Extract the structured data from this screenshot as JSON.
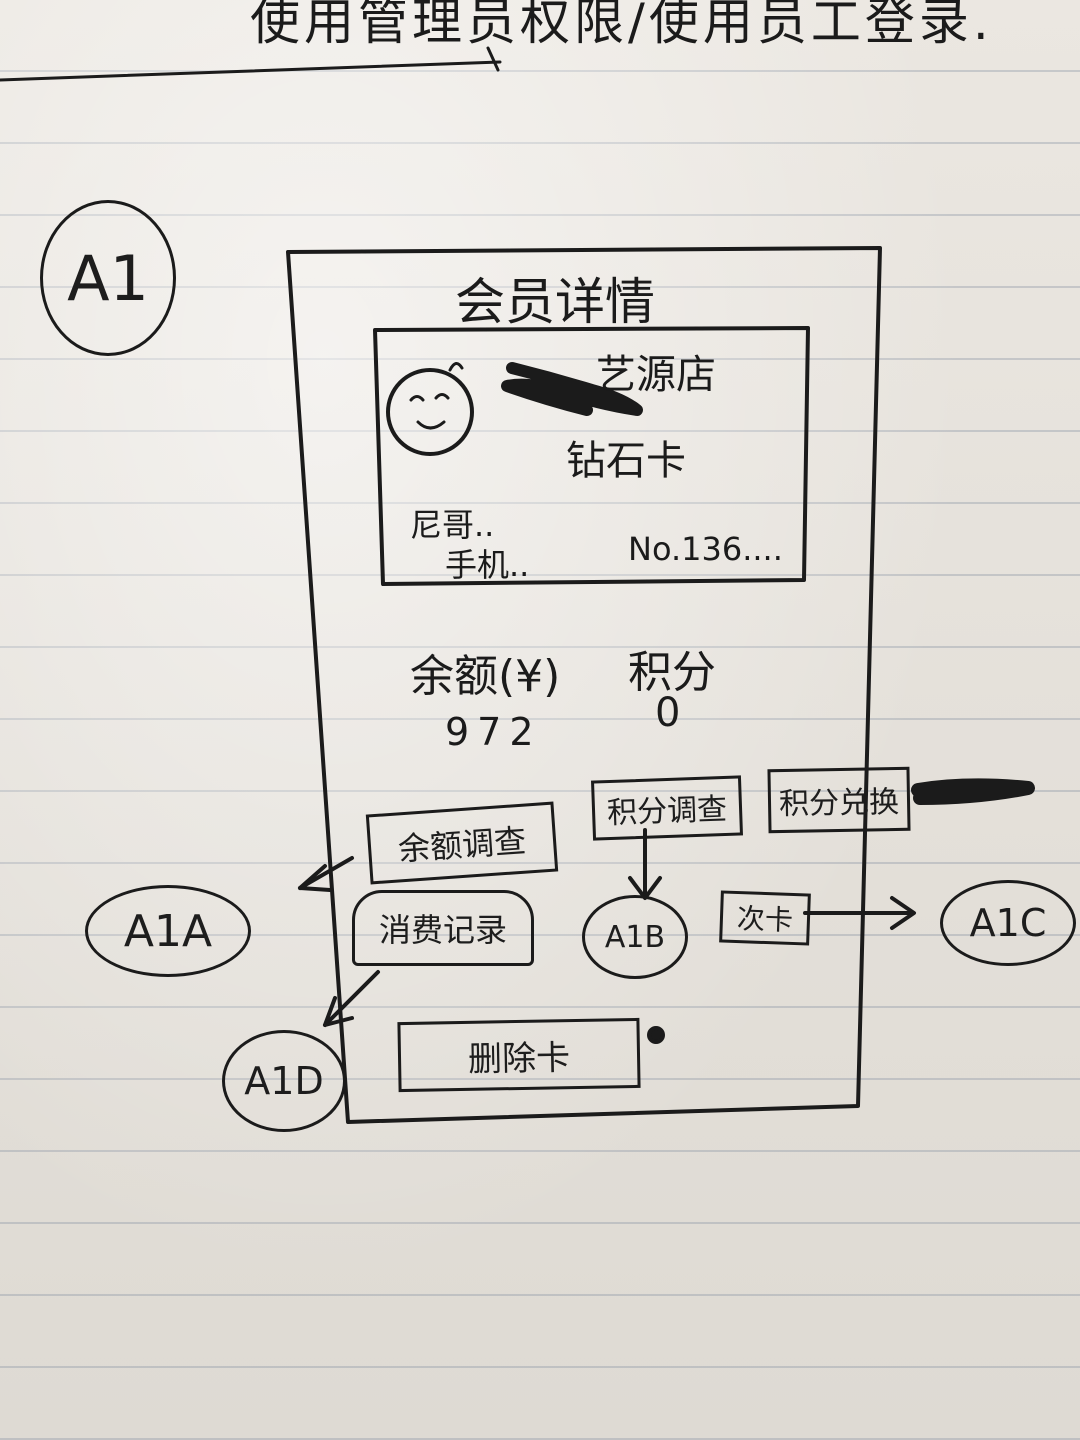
{
  "top_note": "使用管理员权限/使用员工登录.",
  "page_code": "A1",
  "screen": {
    "title": "会员详情",
    "profile": {
      "level_store": "艺源店",
      "member_level": "钻石卡",
      "name_field": "尼哥..",
      "phone_field": "手机..",
      "card_no": "No.136...."
    },
    "stats": {
      "balance_label": "余额(¥)",
      "balance_value": "972",
      "points_label": "积分",
      "points_value": "0"
    },
    "buttons": {
      "balance_query": "余额调查",
      "points_query": "积分调查",
      "points_exchange": "积分兑换",
      "consume_record": "消费记录",
      "times_card": "次卡",
      "delete_card": "删除卡"
    }
  },
  "links": {
    "a1a": "A1A",
    "a1b": "A1B",
    "a1c": "A1C",
    "a1d": "A1D"
  }
}
